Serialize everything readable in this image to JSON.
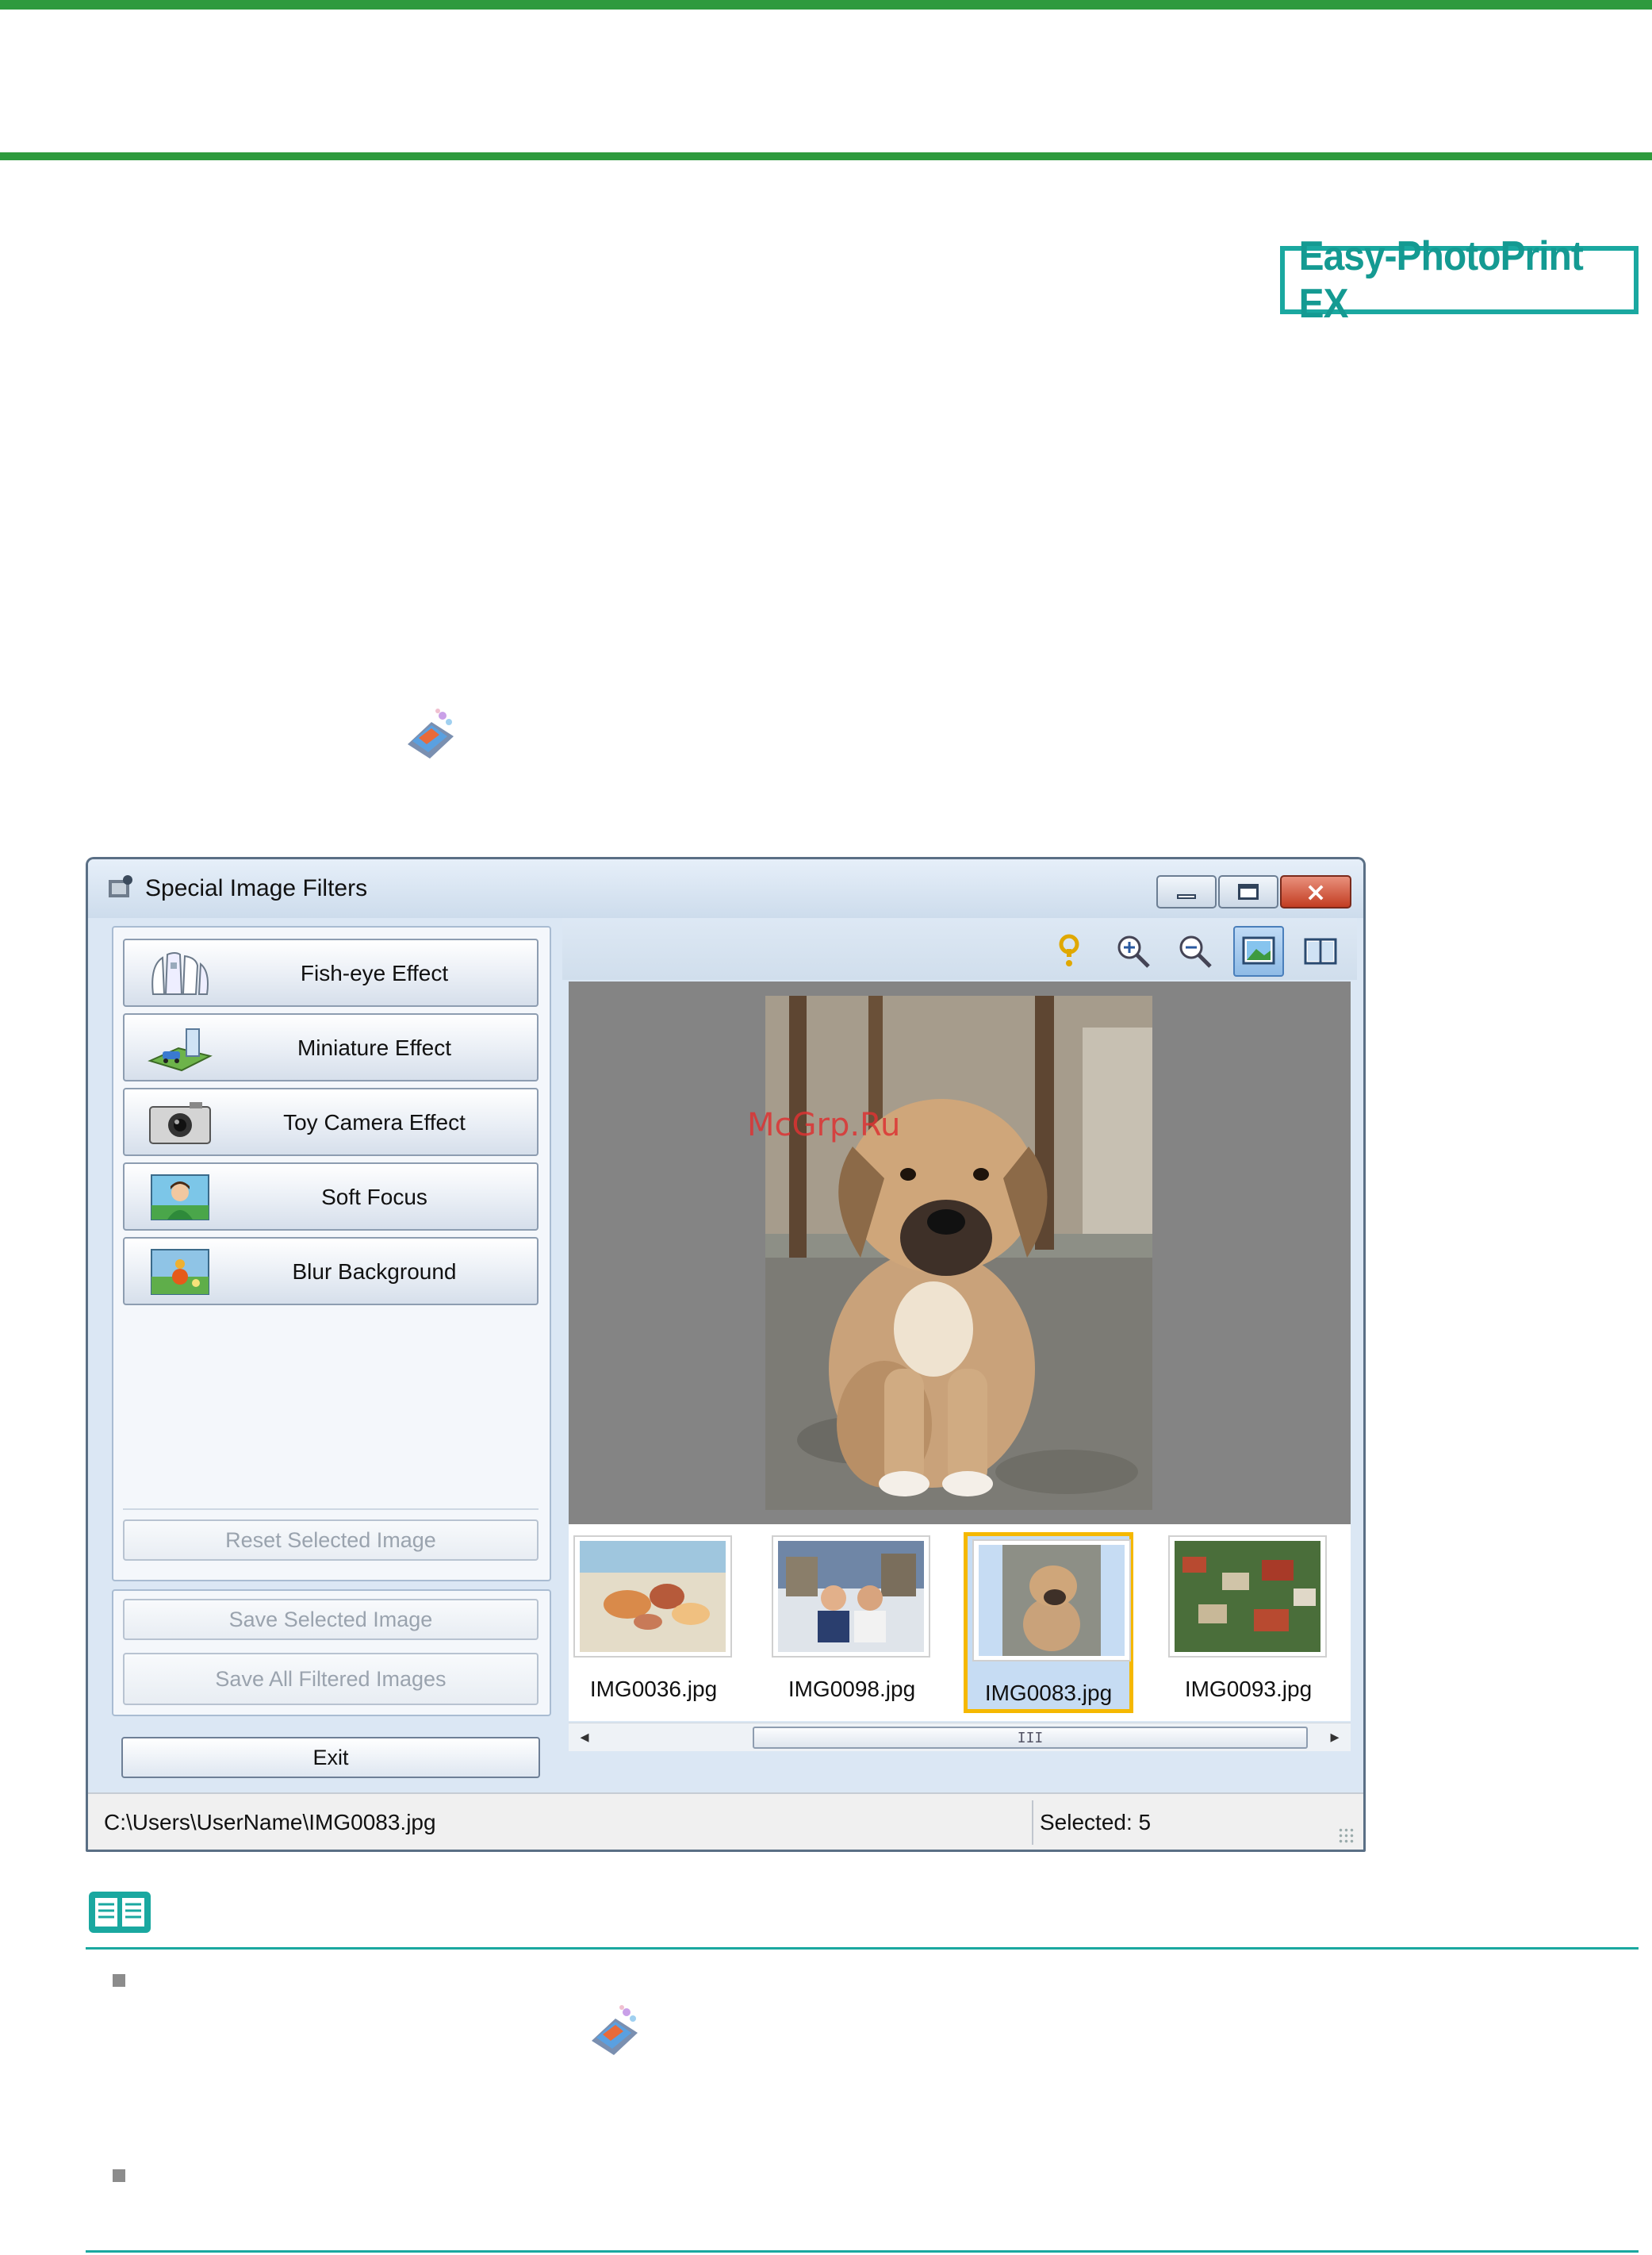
{
  "page": {
    "product_badge": "Easy-PhotoPrint EX",
    "watermark": "McGrp.Ru"
  },
  "window": {
    "title": "Special Image Filters",
    "controls": {
      "minimize": "minimize",
      "maximize": "maximize",
      "close": "×"
    },
    "effects": [
      {
        "label": "Fish-eye Effect",
        "icon": "fisheye-icon"
      },
      {
        "label": "Miniature Effect",
        "icon": "miniature-icon"
      },
      {
        "label": "Toy Camera Effect",
        "icon": "toy-camera-icon"
      },
      {
        "label": "Soft Focus",
        "icon": "soft-focus-icon"
      },
      {
        "label": "Blur Background",
        "icon": "blur-background-icon"
      }
    ],
    "reset_label": "Reset Selected Image",
    "save_selected_label": "Save Selected Image",
    "save_all_label": "Save All Filtered Images",
    "exit_label": "Exit",
    "toolbar": [
      "help-icon",
      "zoom-in-icon",
      "zoom-out-icon",
      "whole-image-view-icon",
      "compare-view-icon"
    ],
    "thumbnails": [
      {
        "label": "IMG0036.jpg",
        "selected": false
      },
      {
        "label": "IMG0098.jpg",
        "selected": false
      },
      {
        "label": "IMG0083.jpg",
        "selected": true
      },
      {
        "label": "IMG0093.jpg",
        "selected": false
      }
    ],
    "scroll_grip": "III",
    "status": {
      "path": "C:\\Users\\UserName\\IMG0083.jpg",
      "selected": "Selected: 5"
    }
  },
  "colors": {
    "page_rule": "#2e9a3e",
    "accent_teal": "#1aa8a0",
    "selection_border": "#f5b800"
  }
}
